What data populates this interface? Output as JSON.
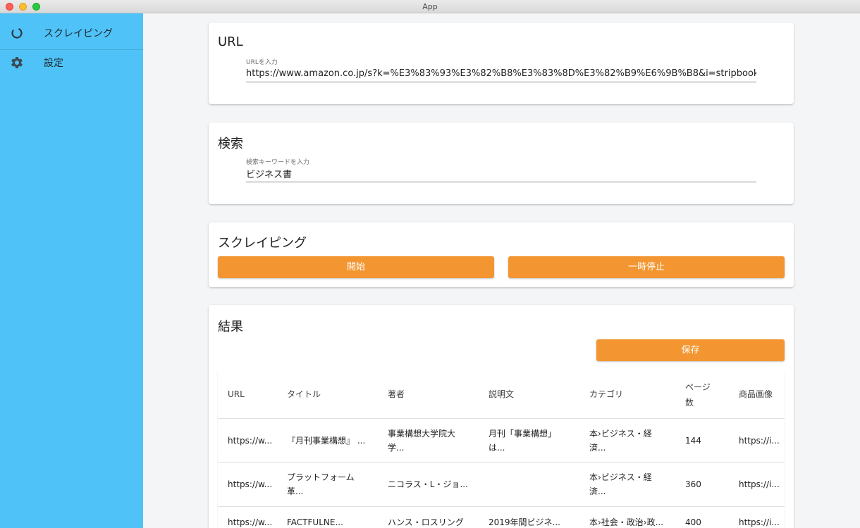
{
  "window": {
    "title": "App"
  },
  "sidebar": {
    "items": [
      {
        "label": "スクレイピング",
        "icon": "loading-ring-icon"
      },
      {
        "label": "設定",
        "icon": "gear-icon"
      }
    ]
  },
  "url_card": {
    "title": "URL",
    "field_label": "URLを入力",
    "value": "https://www.amazon.co.jp/s?k=%E3%83%93%E3%82%B8%E3%83%8D%E3%82%B9%E6%9B%B8&i=stripbooks&__mk_ja_"
  },
  "search_card": {
    "title": "検索",
    "field_label": "検索キーワードを入力",
    "value": "ビジネス書"
  },
  "scraping_card": {
    "title": "スクレイピング",
    "start_label": "開始",
    "pause_label": "一時停止"
  },
  "results_card": {
    "title": "結果",
    "save_label": "保存",
    "columns": {
      "url": "URL",
      "title": "タイトル",
      "author": "著者",
      "description": "説明文",
      "category": "カテゴリ",
      "pages": "ページ数",
      "image": "商品画像"
    },
    "rows": [
      {
        "url": "https://w...",
        "title": "『月刊事業構想』 ...",
        "author": "事業構想大学院大学...",
        "description": "月刊「事業構想」は...",
        "category": "本›ビジネス・経済...",
        "pages": "144",
        "image": "https://i..."
      },
      {
        "url": "https://w...",
        "title": "プラットフォーム革...",
        "author": "ニコラス・L・ジョ...",
        "description": "",
        "category": "本›ビジネス・経済...",
        "pages": "360",
        "image": "https://i..."
      },
      {
        "url": "https://w...",
        "title": "FACTFULNE...",
        "author": "ハンス・ロスリング",
        "description": "2019年間ビジネ...",
        "category": "本›社会・政治›政...",
        "pages": "400",
        "image": "https://i..."
      }
    ]
  },
  "colors": {
    "sidebar": "#4fc3f7",
    "accent": "#f39631",
    "background": "#f4f5f7"
  }
}
